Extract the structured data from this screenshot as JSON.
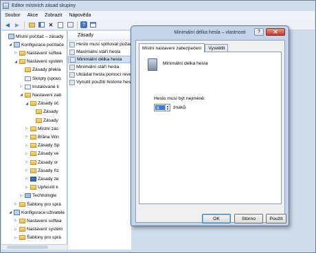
{
  "window": {
    "title": "Editor místních zásad skupiny"
  },
  "menu": [
    "Soubor",
    "Akce",
    "Zobrazit",
    "Nápověda"
  ],
  "toolbar": [
    "back-icon",
    "forward-icon",
    "folder-up-icon",
    "console-tree-icon",
    "delete-icon",
    "properties-icon",
    "export-icon",
    "help-icon",
    "show-hide-icon"
  ],
  "tree": [
    {
      "label": "Místní počítač – zásady",
      "level": 0,
      "twisty": "",
      "icon": "computer"
    },
    {
      "label": "Konfigurace počítače",
      "level": 1,
      "twisty": "◢",
      "icon": "computer"
    },
    {
      "label": "Nastavení softwa",
      "level": 2,
      "twisty": "▷",
      "icon": "folder"
    },
    {
      "label": "Nastavení systém",
      "level": 2,
      "twisty": "◢",
      "icon": "folder"
    },
    {
      "label": "Zásady překla",
      "level": 3,
      "twisty": "",
      "icon": "folder"
    },
    {
      "label": "Skripty (spous",
      "level": 3,
      "twisty": "",
      "icon": "doc"
    },
    {
      "label": "Instalované ti",
      "level": 3,
      "twisty": "▷",
      "icon": "doc"
    },
    {
      "label": "Nastavení zab",
      "level": 3,
      "twisty": "◢",
      "icon": "folder"
    },
    {
      "label": "Zásady úč",
      "level": 4,
      "twisty": "◢",
      "icon": "folder"
    },
    {
      "label": "Zásady",
      "level": 5,
      "twisty": "",
      "icon": "folder"
    },
    {
      "label": "Zásady",
      "level": 5,
      "twisty": "",
      "icon": "folder"
    },
    {
      "label": "Místní zás",
      "level": 4,
      "twisty": "▷",
      "icon": "folder"
    },
    {
      "label": "Brána Win",
      "level": 4,
      "twisty": "▷",
      "icon": "folder"
    },
    {
      "label": "Zásady Sp",
      "level": 4,
      "twisty": "▷",
      "icon": "folder"
    },
    {
      "label": "Zásady ve",
      "level": 4,
      "twisty": "▷",
      "icon": "folder"
    },
    {
      "label": "Zásady or",
      "level": 4,
      "twisty": "▷",
      "icon": "folder"
    },
    {
      "label": "Zásady říz",
      "level": 4,
      "twisty": "▷",
      "icon": "folder"
    },
    {
      "label": "Zásady ze",
      "level": 4,
      "twisty": "▷",
      "icon": "shield"
    },
    {
      "label": "Upřesnit k",
      "level": 4,
      "twisty": "▷",
      "icon": "folder"
    },
    {
      "label": "Technologie",
      "level": 3,
      "twisty": "▷",
      "icon": "chart"
    },
    {
      "label": "Šablony pro sprá",
      "level": 2,
      "twisty": "▷",
      "icon": "folder"
    },
    {
      "label": "Konfigurace uživatele",
      "level": 1,
      "twisty": "◢",
      "icon": "computer"
    },
    {
      "label": "Nastavení softwa",
      "level": 2,
      "twisty": "▷",
      "icon": "folder"
    },
    {
      "label": "Nastavení systém",
      "level": 2,
      "twisty": "▷",
      "icon": "folder"
    },
    {
      "label": "Šablony pro sprá",
      "level": 2,
      "twisty": "▷",
      "icon": "folder"
    }
  ],
  "list": {
    "header": "Zásady",
    "items": [
      {
        "label": "Heslo musí splňovat požada",
        "selected": false
      },
      {
        "label": "Maximální stáří hesla",
        "selected": false
      },
      {
        "label": "Minimální délka hesla",
        "selected": true
      },
      {
        "label": "Minimální stáří hesla",
        "selected": false
      },
      {
        "label": "Ukládat hesla pomocí reve",
        "selected": false
      },
      {
        "label": "Vynutit použití historie hesl",
        "selected": false
      }
    ]
  },
  "dialog": {
    "title": "Minimální délka hesla – vlastnosti",
    "help_button": "?",
    "close_button": "✕",
    "tabs": [
      {
        "label": "Místní nastavení zabezpečení",
        "active": true
      },
      {
        "label": "Vysvětlit",
        "active": false
      }
    ],
    "policy_name": "Minimální délka hesla",
    "field_label": "Heslo musí být nejméně:",
    "field_value": "8",
    "field_unit": "znaků",
    "buttons": {
      "ok": "OK",
      "cancel": "Storno",
      "apply": "Použít"
    }
  }
}
